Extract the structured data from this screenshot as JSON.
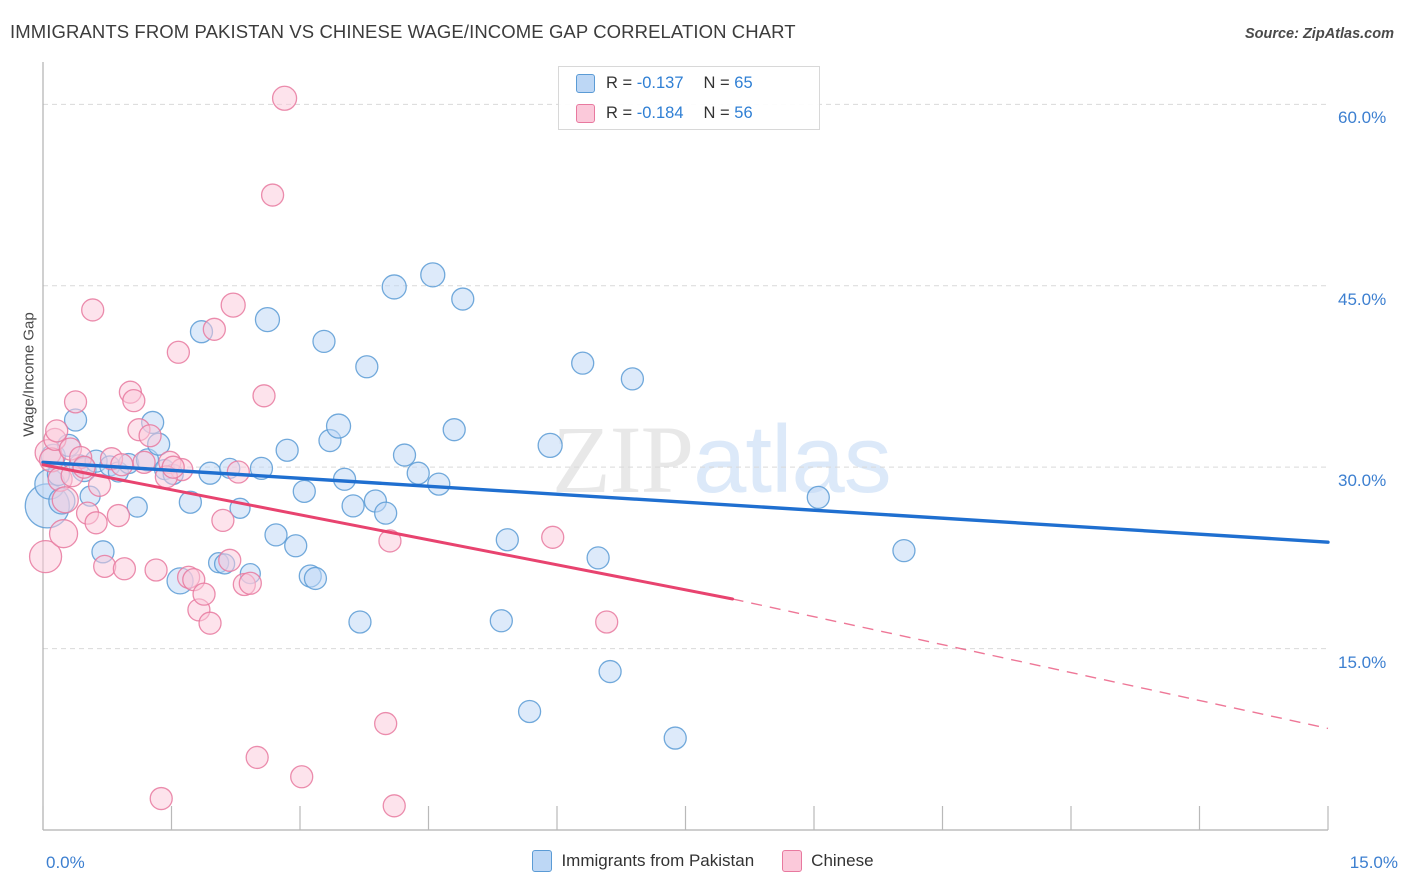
{
  "header": {
    "title": "IMMIGRANTS FROM PAKISTAN VS CHINESE WAGE/INCOME GAP CORRELATION CHART",
    "source": "Source: ZipAtlas.com"
  },
  "watermark": {
    "part1": "ZIP",
    "part2": "atlas"
  },
  "stats": {
    "rows": [
      {
        "series": "Immigrants from Pakistan",
        "r_label": "R =",
        "r_value": "-0.137",
        "n_label": "N =",
        "n_value": "65",
        "color": "#bdd7f5"
      },
      {
        "series": "Chinese",
        "r_label": "R =",
        "r_value": "-0.184",
        "n_label": "N =",
        "n_value": "56",
        "color": "#fbc9da"
      }
    ]
  },
  "legend": {
    "items": [
      {
        "label": "Immigrants from Pakistan",
        "color": "#bdd7f5",
        "border": "#5b9bd5"
      },
      {
        "label": "Chinese",
        "color": "#fbc9da",
        "border": "#e8799f"
      }
    ]
  },
  "axes": {
    "y_label": "Wage/Income Gap",
    "y_ticks": [
      "60.0%",
      "45.0%",
      "30.0%",
      "15.0%"
    ],
    "x_min_label": "0.0%",
    "x_max_label": "15.0%"
  },
  "chart_data": {
    "type": "scatter",
    "title": "IMMIGRANTS FROM PAKISTAN VS CHINESE WAGE/INCOME GAP CORRELATION CHART",
    "xlabel": "",
    "ylabel": "Wage/Income Gap",
    "xlim": [
      0,
      15
    ],
    "ylim": [
      0,
      63.5
    ],
    "x_unit": "%",
    "y_unit": "%",
    "grid": true,
    "y_gridlines": [
      15,
      30,
      45,
      60
    ],
    "legend_position": "bottom-center",
    "series": [
      {
        "name": "Immigrants from Pakistan",
        "color": "#bdd7f5",
        "border": "#5b9bd5",
        "r": -0.137,
        "n": 65,
        "trend": {
          "x0": 0.0,
          "y0": 30.4,
          "x1": 15.0,
          "y1": 23.8,
          "style": "solid",
          "color": "#1f6fd0"
        },
        "points": [
          {
            "x": 0.05,
            "y": 26.8,
            "r": 22
          },
          {
            "x": 0.08,
            "y": 28.6,
            "r": 15
          },
          {
            "x": 0.12,
            "y": 30.9,
            "r": 12
          },
          {
            "x": 0.18,
            "y": 29.4,
            "r": 11
          },
          {
            "x": 0.22,
            "y": 27.2,
            "r": 13
          },
          {
            "x": 0.3,
            "y": 31.8,
            "r": 11
          },
          {
            "x": 0.38,
            "y": 33.9,
            "r": 11
          },
          {
            "x": 0.42,
            "y": 30.2,
            "r": 10
          },
          {
            "x": 0.48,
            "y": 29.8,
            "r": 12
          },
          {
            "x": 0.55,
            "y": 27.6,
            "r": 10
          },
          {
            "x": 0.62,
            "y": 30.5,
            "r": 11
          },
          {
            "x": 0.7,
            "y": 23.0,
            "r": 11
          },
          {
            "x": 0.78,
            "y": 30.1,
            "r": 10
          },
          {
            "x": 0.88,
            "y": 29.6,
            "r": 10
          },
          {
            "x": 1.0,
            "y": 30.3,
            "r": 10
          },
          {
            "x": 1.1,
            "y": 26.7,
            "r": 10
          },
          {
            "x": 1.22,
            "y": 30.6,
            "r": 11
          },
          {
            "x": 1.35,
            "y": 31.9,
            "r": 11
          },
          {
            "x": 1.42,
            "y": 29.8,
            "r": 10
          },
          {
            "x": 1.52,
            "y": 29.4,
            "r": 10
          },
          {
            "x": 1.6,
            "y": 20.6,
            "r": 13
          },
          {
            "x": 1.72,
            "y": 27.1,
            "r": 11
          },
          {
            "x": 1.85,
            "y": 41.2,
            "r": 11
          },
          {
            "x": 1.95,
            "y": 29.5,
            "r": 11
          },
          {
            "x": 2.05,
            "y": 22.1,
            "r": 10
          },
          {
            "x": 2.12,
            "y": 22.0,
            "r": 10
          },
          {
            "x": 2.3,
            "y": 26.6,
            "r": 10
          },
          {
            "x": 2.42,
            "y": 21.2,
            "r": 10
          },
          {
            "x": 2.55,
            "y": 29.9,
            "r": 11
          },
          {
            "x": 2.62,
            "y": 42.2,
            "r": 12
          },
          {
            "x": 2.72,
            "y": 24.4,
            "r": 11
          },
          {
            "x": 2.85,
            "y": 31.4,
            "r": 11
          },
          {
            "x": 2.95,
            "y": 23.5,
            "r": 11
          },
          {
            "x": 3.05,
            "y": 28.0,
            "r": 11
          },
          {
            "x": 3.12,
            "y": 21.0,
            "r": 11
          },
          {
            "x": 3.18,
            "y": 20.8,
            "r": 11
          },
          {
            "x": 3.28,
            "y": 40.4,
            "r": 11
          },
          {
            "x": 3.35,
            "y": 32.2,
            "r": 11
          },
          {
            "x": 3.45,
            "y": 33.4,
            "r": 12
          },
          {
            "x": 3.52,
            "y": 29.0,
            "r": 11
          },
          {
            "x": 3.62,
            "y": 26.8,
            "r": 11
          },
          {
            "x": 3.7,
            "y": 17.2,
            "r": 11
          },
          {
            "x": 3.78,
            "y": 38.3,
            "r": 11
          },
          {
            "x": 3.88,
            "y": 27.2,
            "r": 11
          },
          {
            "x": 4.0,
            "y": 26.2,
            "r": 11
          },
          {
            "x": 4.1,
            "y": 44.9,
            "r": 12
          },
          {
            "x": 4.22,
            "y": 31.0,
            "r": 11
          },
          {
            "x": 4.38,
            "y": 29.5,
            "r": 11
          },
          {
            "x": 4.55,
            "y": 45.9,
            "r": 12
          },
          {
            "x": 4.62,
            "y": 28.6,
            "r": 11
          },
          {
            "x": 4.8,
            "y": 33.1,
            "r": 11
          },
          {
            "x": 4.9,
            "y": 43.9,
            "r": 11
          },
          {
            "x": 5.35,
            "y": 17.3,
            "r": 11
          },
          {
            "x": 5.42,
            "y": 24.0,
            "r": 11
          },
          {
            "x": 5.68,
            "y": 9.8,
            "r": 11
          },
          {
            "x": 5.92,
            "y": 31.8,
            "r": 12
          },
          {
            "x": 6.3,
            "y": 38.6,
            "r": 11
          },
          {
            "x": 6.48,
            "y": 22.5,
            "r": 11
          },
          {
            "x": 6.62,
            "y": 13.1,
            "r": 11
          },
          {
            "x": 6.88,
            "y": 37.3,
            "r": 11
          },
          {
            "x": 7.38,
            "y": 7.6,
            "r": 11
          },
          {
            "x": 9.05,
            "y": 27.5,
            "r": 11
          },
          {
            "x": 10.05,
            "y": 23.1,
            "r": 11
          },
          {
            "x": 2.18,
            "y": 29.9,
            "r": 10
          },
          {
            "x": 1.28,
            "y": 33.7,
            "r": 11
          }
        ]
      },
      {
        "name": "Chinese",
        "color": "#fbc9da",
        "border": "#e8799f",
        "r": -0.184,
        "n": 56,
        "trend": {
          "x0": 0.0,
          "y0": 30.2,
          "x1": 8.05,
          "y1": 19.1,
          "style": "solid",
          "color": "#e8436f",
          "dash_from_x": 8.05,
          "dash_to_x": 15.0,
          "dash_y1": 8.4
        },
        "points": [
          {
            "x": 0.03,
            "y": 22.6,
            "r": 16
          },
          {
            "x": 0.06,
            "y": 31.2,
            "r": 13
          },
          {
            "x": 0.1,
            "y": 30.6,
            "r": 12
          },
          {
            "x": 0.14,
            "y": 32.3,
            "r": 11
          },
          {
            "x": 0.2,
            "y": 29.0,
            "r": 12
          },
          {
            "x": 0.26,
            "y": 27.3,
            "r": 13
          },
          {
            "x": 0.32,
            "y": 31.5,
            "r": 11
          },
          {
            "x": 0.38,
            "y": 35.4,
            "r": 11
          },
          {
            "x": 0.44,
            "y": 30.8,
            "r": 11
          },
          {
            "x": 0.52,
            "y": 26.2,
            "r": 11
          },
          {
            "x": 0.58,
            "y": 43.0,
            "r": 11
          },
          {
            "x": 0.66,
            "y": 28.5,
            "r": 11
          },
          {
            "x": 0.72,
            "y": 21.8,
            "r": 11
          },
          {
            "x": 0.8,
            "y": 30.7,
            "r": 11
          },
          {
            "x": 0.88,
            "y": 26.0,
            "r": 11
          },
          {
            "x": 0.95,
            "y": 21.6,
            "r": 11
          },
          {
            "x": 1.02,
            "y": 36.2,
            "r": 11
          },
          {
            "x": 1.06,
            "y": 35.5,
            "r": 11
          },
          {
            "x": 1.12,
            "y": 33.1,
            "r": 11
          },
          {
            "x": 1.18,
            "y": 30.4,
            "r": 11
          },
          {
            "x": 1.25,
            "y": 32.6,
            "r": 11
          },
          {
            "x": 1.32,
            "y": 21.5,
            "r": 11
          },
          {
            "x": 1.38,
            "y": 2.6,
            "r": 11
          },
          {
            "x": 1.48,
            "y": 30.4,
            "r": 11
          },
          {
            "x": 1.58,
            "y": 39.5,
            "r": 11
          },
          {
            "x": 1.62,
            "y": 29.8,
            "r": 11
          },
          {
            "x": 1.7,
            "y": 20.9,
            "r": 11
          },
          {
            "x": 1.76,
            "y": 20.7,
            "r": 11
          },
          {
            "x": 1.82,
            "y": 18.2,
            "r": 11
          },
          {
            "x": 1.88,
            "y": 19.5,
            "r": 11
          },
          {
            "x": 1.95,
            "y": 17.1,
            "r": 11
          },
          {
            "x": 2.0,
            "y": 41.4,
            "r": 11
          },
          {
            "x": 2.1,
            "y": 25.6,
            "r": 11
          },
          {
            "x": 2.18,
            "y": 22.3,
            "r": 11
          },
          {
            "x": 2.22,
            "y": 43.4,
            "r": 12
          },
          {
            "x": 2.35,
            "y": 20.3,
            "r": 11
          },
          {
            "x": 2.42,
            "y": 20.4,
            "r": 11
          },
          {
            "x": 2.5,
            "y": 6.0,
            "r": 11
          },
          {
            "x": 2.58,
            "y": 35.9,
            "r": 11
          },
          {
            "x": 2.68,
            "y": 52.5,
            "r": 11
          },
          {
            "x": 2.82,
            "y": 60.5,
            "r": 12
          },
          {
            "x": 3.02,
            "y": 4.4,
            "r": 11
          },
          {
            "x": 4.0,
            "y": 8.8,
            "r": 11
          },
          {
            "x": 4.05,
            "y": 23.9,
            "r": 11
          },
          {
            "x": 4.1,
            "y": 2.0,
            "r": 11
          },
          {
            "x": 5.95,
            "y": 24.2,
            "r": 11
          },
          {
            "x": 6.58,
            "y": 17.2,
            "r": 11
          },
          {
            "x": 0.16,
            "y": 33.0,
            "r": 11
          },
          {
            "x": 0.34,
            "y": 29.3,
            "r": 11
          },
          {
            "x": 0.48,
            "y": 30.0,
            "r": 11
          },
          {
            "x": 0.62,
            "y": 25.4,
            "r": 11
          },
          {
            "x": 1.44,
            "y": 29.2,
            "r": 11
          },
          {
            "x": 1.52,
            "y": 30.0,
            "r": 11
          },
          {
            "x": 2.28,
            "y": 29.6,
            "r": 11
          },
          {
            "x": 0.92,
            "y": 30.2,
            "r": 11
          },
          {
            "x": 0.24,
            "y": 24.5,
            "r": 14
          }
        ]
      }
    ]
  }
}
